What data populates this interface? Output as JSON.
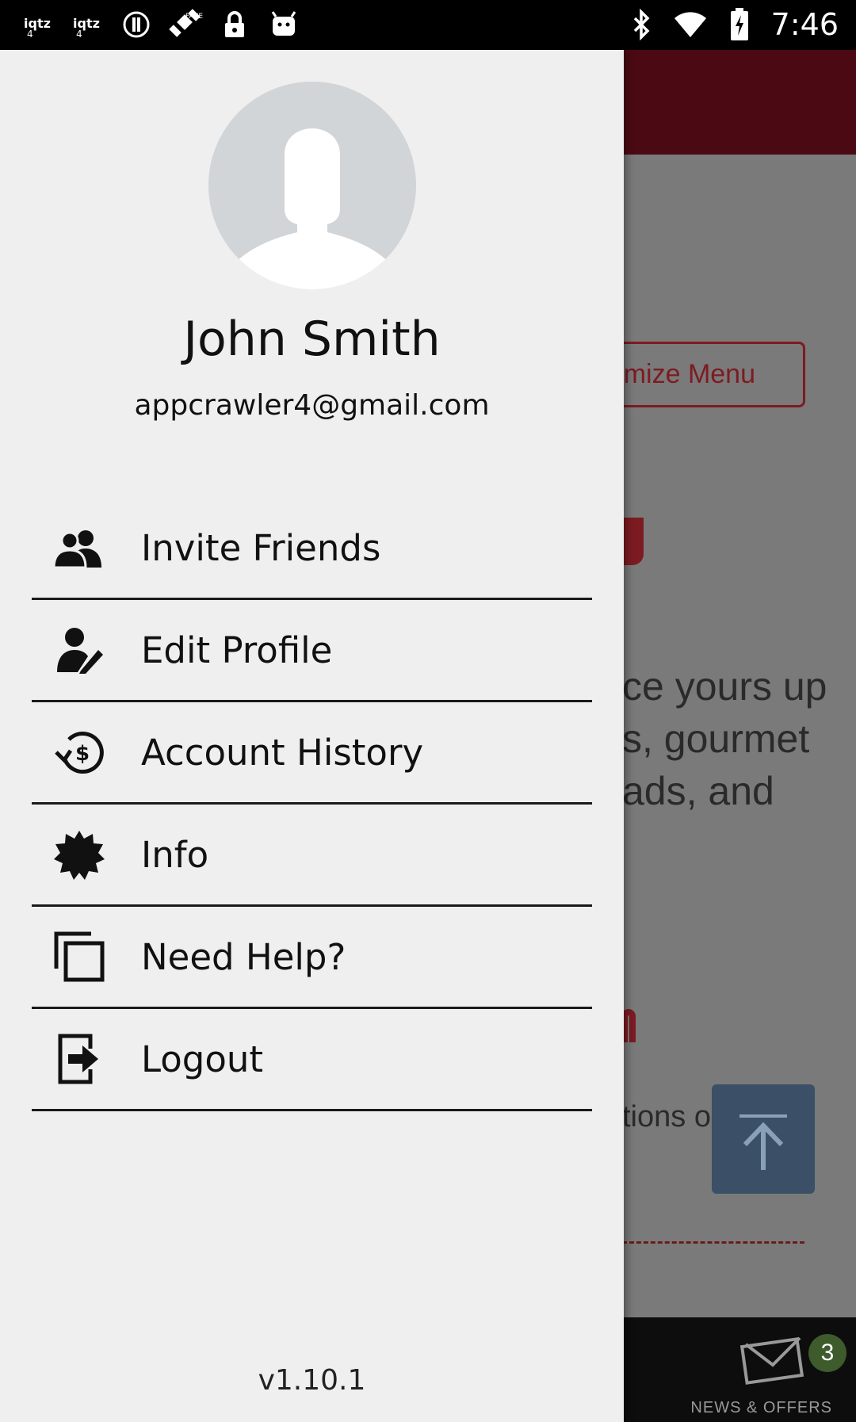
{
  "status_bar": {
    "time": "7:46",
    "left_icons": [
      "iqtz-icon",
      "iqtz-icon",
      "alert-circle-icon",
      "satellite-icon",
      "lock-icon",
      "android-icon"
    ],
    "right_icons": [
      "bluetooth-icon",
      "wifi-icon",
      "battery-icon"
    ]
  },
  "background_app": {
    "customize_button_partial": "mize Menu",
    "body_partial": "ce yours up\ns, gourmet\nads, and",
    "small_partial": "tions only.)",
    "tab_label_partial": "NEWS & OFFERS",
    "badge_count": "3"
  },
  "drawer": {
    "user": {
      "name": "John Smith",
      "email": "appcrawler4@gmail.com"
    },
    "menu": [
      {
        "label": "Invite Friends",
        "icon": "people-icon"
      },
      {
        "label": "Edit Profile",
        "icon": "edit-profile-icon"
      },
      {
        "label": "Account History",
        "icon": "dollar-history-icon"
      },
      {
        "label": "Info",
        "icon": "starburst-icon"
      },
      {
        "label": "Need Help?",
        "icon": "copy-icon"
      },
      {
        "label": "Logout",
        "icon": "logout-icon"
      }
    ],
    "version": "v1.10.1"
  },
  "colors": {
    "drawer_bg": "#efefef",
    "header_dark_red": "#4b0a13",
    "accent_red": "#7d1b22"
  }
}
